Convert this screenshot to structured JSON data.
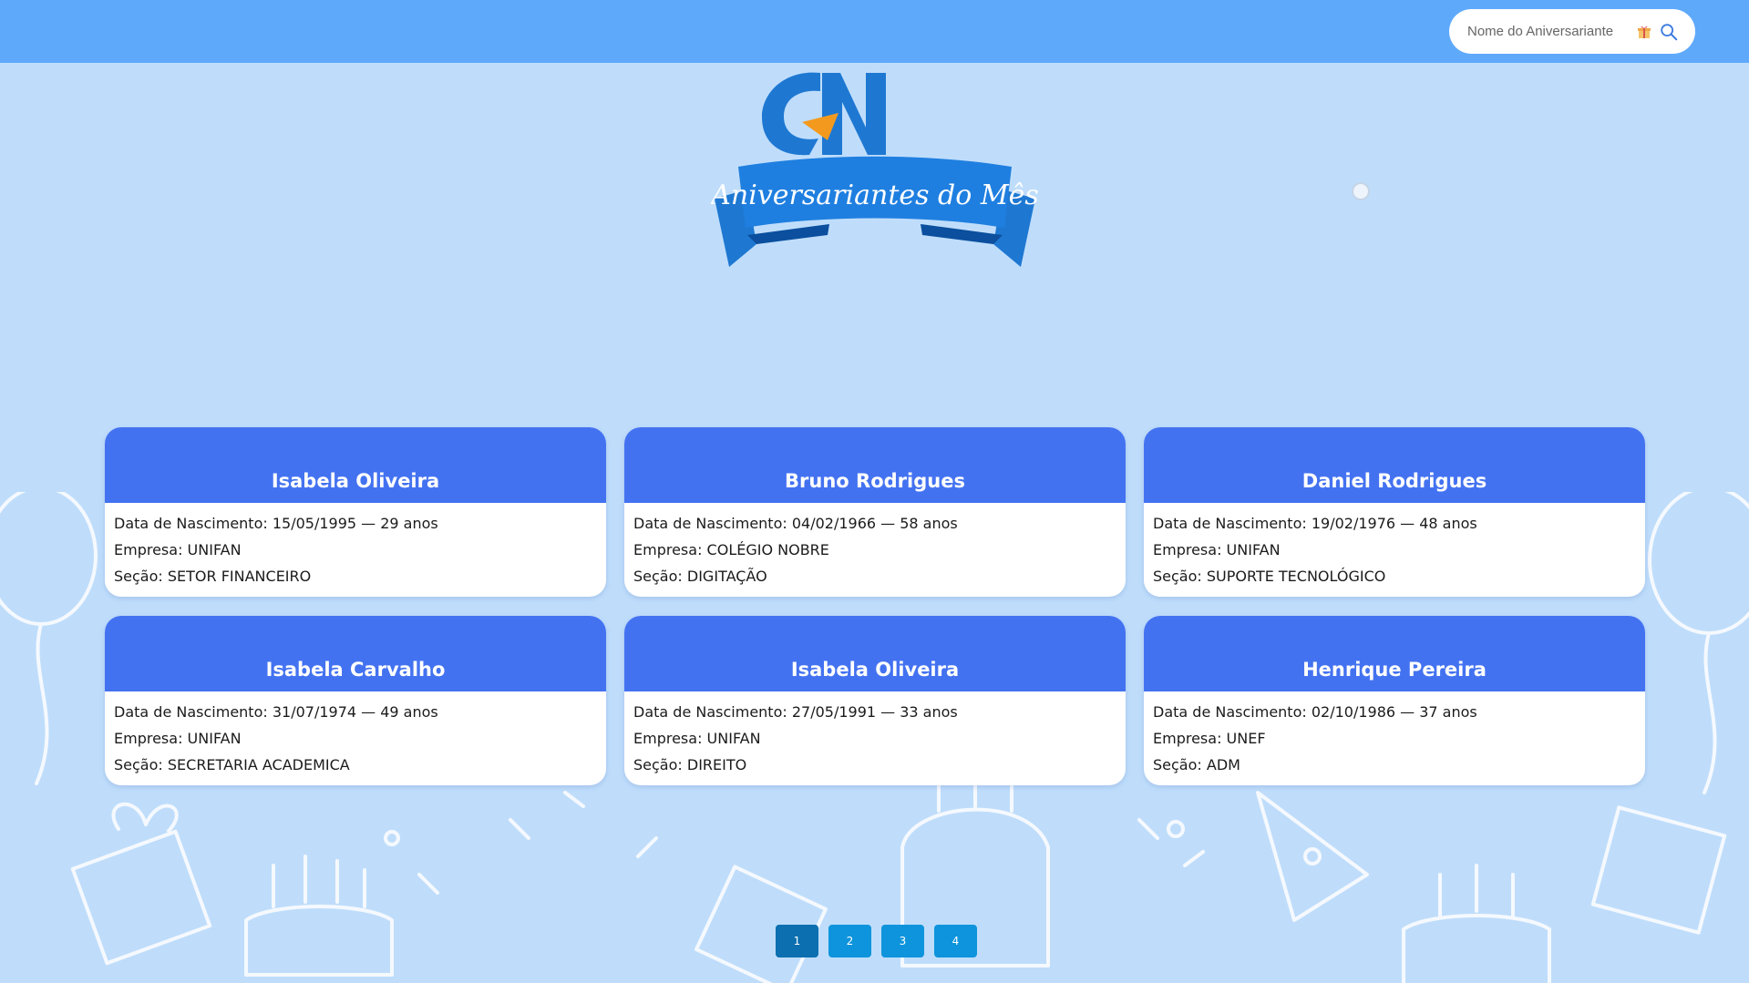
{
  "search": {
    "placeholder": "Nome do Aniversariante"
  },
  "logo": {
    "monogram": "CN",
    "banner_text": "Aniversariantes do Mês"
  },
  "labels": {
    "birth": "Data de Nascimento: ",
    "company": "Empresa: ",
    "section": "Seção: "
  },
  "cards": [
    {
      "name": "Isabela Oliveira",
      "birth": "15/05/1995 — 29 anos",
      "company": "UNIFAN",
      "section": "SETOR FINANCEIRO"
    },
    {
      "name": "Bruno Rodrigues",
      "birth": "04/02/1966 — 58 anos",
      "company": "COLÉGIO NOBRE",
      "section": "DIGITAÇÃO"
    },
    {
      "name": "Daniel Rodrigues",
      "birth": "19/02/1976 — 48 anos",
      "company": "UNIFAN",
      "section": "SUPORTE TECNOLÓGICO"
    },
    {
      "name": "Isabela Carvalho",
      "birth": "31/07/1974 — 49 anos",
      "company": "UNIFAN",
      "section": "SECRETARIA ACADEMICA"
    },
    {
      "name": "Isabela Oliveira",
      "birth": "27/05/1991 — 33 anos",
      "company": "UNIFAN",
      "section": "DIREITO"
    },
    {
      "name": "Henrique Pereira",
      "birth": "02/10/1986 — 37 anos",
      "company": "UNEF",
      "section": "ADM"
    }
  ],
  "pagination": {
    "pages": [
      "1",
      "2",
      "3",
      "4"
    ],
    "active": "1"
  },
  "colors": {
    "topbar": "#5fa9fb",
    "background": "#bfddfb",
    "card_header": "#4372f1",
    "page_button": "#0e94dc",
    "logo_blue": "#1e78d2",
    "logo_orange": "#f39a1e"
  },
  "icons": {
    "search": "search-icon",
    "gift": "gift-icon"
  }
}
